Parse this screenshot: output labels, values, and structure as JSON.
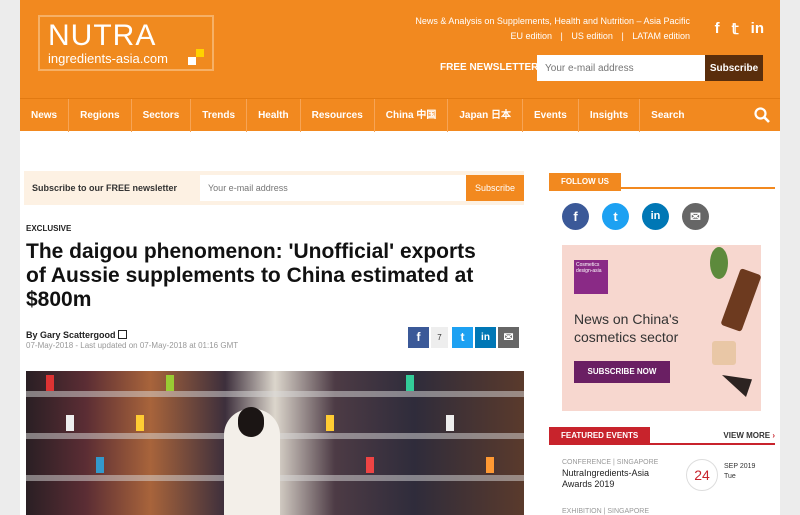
{
  "header": {
    "logo_big": "NUTRA",
    "logo_small": "ingredients-asia.com",
    "tagline": "News & Analysis on Supplements, Health and Nutrition – Asia Pacific",
    "editions": [
      "EU edition",
      "|",
      "US edition",
      "|",
      "LATAM edition"
    ],
    "social": [
      "f",
      "𝕥",
      "in"
    ],
    "newsletter_label": "FREE NEWSLETTER",
    "email_placeholder": "Your e-mail address",
    "subscribe_label": "Subscribe"
  },
  "nav": {
    "items": [
      "News",
      "Regions",
      "Sectors",
      "Trends",
      "Health",
      "Resources",
      "China 中国",
      "Japan 日本",
      "Events",
      "Insights",
      "Search"
    ]
  },
  "subscribe_box": {
    "label": "Subscribe to our FREE newsletter",
    "placeholder": "Your e-mail address",
    "button": "Subscribe"
  },
  "article": {
    "kicker": "EXCLUSIVE",
    "headline": "The daigou phenomenon: 'Unofficial' exports of Aussie supplements to China estimated at $800m",
    "byline": "By Gary Scattergood",
    "dates": "07-May-2018 - Last updated on 07-May-2018 at 01:16 GMT",
    "share_count": "7"
  },
  "sidebar": {
    "follow_label": "FOLLOW US",
    "ad": {
      "logo_text": "Cosmetics design-asia",
      "headline": "News on China's cosmetics sector",
      "cta": "SUBSCRIBE NOW"
    },
    "featured_label": "FEATURED EVENTS",
    "view_more": "VIEW MORE",
    "events": [
      {
        "meta": "CONFERENCE | SINGAPORE",
        "name": "NutraIngredients-Asia Awards 2019",
        "day_num": "24",
        "month": "SEP 2019",
        "weekday": "Tue"
      },
      {
        "meta": "EXHIBITION | SINGAPORE"
      }
    ]
  },
  "colors": {
    "brand_orange": "#f2891f",
    "facebook": "#3b5998",
    "twitter": "#1da1f2",
    "linkedin": "#0077b5",
    "email": "#666666",
    "featured_red": "#c8232c"
  }
}
